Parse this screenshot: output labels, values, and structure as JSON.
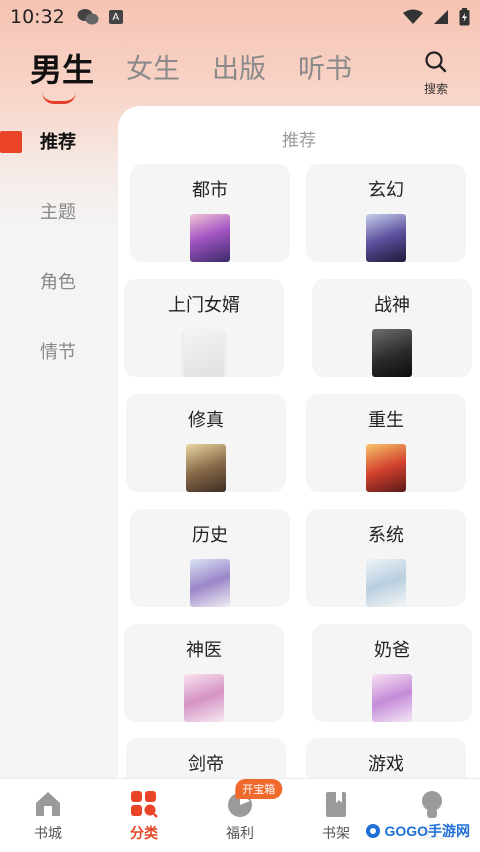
{
  "status_bar": {
    "time": "10:32"
  },
  "header": {
    "tabs": [
      "男生",
      "女生",
      "出版",
      "听书"
    ],
    "active_tab": 0,
    "search_label": "搜索"
  },
  "sidebar": {
    "items": [
      "推荐",
      "主题",
      "角色",
      "情节"
    ],
    "active_index": 0
  },
  "panel": {
    "title": "推荐",
    "categories": [
      "都市",
      "玄幻",
      "上门女婿",
      "战神",
      "修真",
      "重生",
      "历史",
      "系统",
      "神医",
      "奶爸",
      "剑帝",
      "游戏"
    ]
  },
  "bottom_nav": {
    "items": [
      "书城",
      "分类",
      "福利",
      "书架",
      "我的"
    ],
    "active_index": 1,
    "welfare_badge": "开宝箱"
  },
  "watermark": {
    "text": "GOGO手游网"
  },
  "colors": {
    "accent": "#e94428",
    "badge": "#f06a2e",
    "card_bg": "#f5f5f5"
  }
}
